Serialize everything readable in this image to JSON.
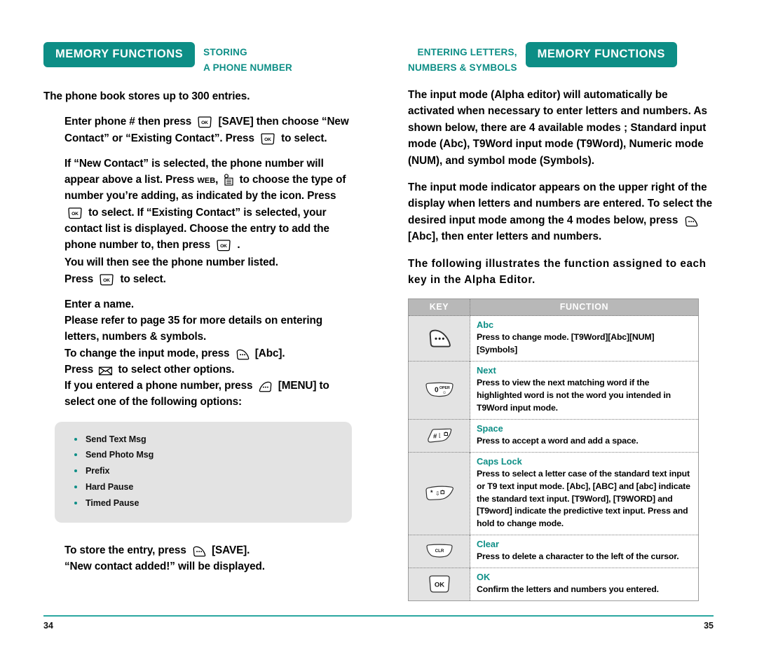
{
  "left_page": {
    "badge": "MEMORY FUNCTIONS",
    "section_title_line1": "STORING",
    "section_title_line2": "A PHONE NUMBER",
    "intro": "The phone book stores up to 300 entries.",
    "p1_a": "Enter phone # then press",
    "p1_b": "[SAVE] then choose “New Contact” or “Existing Contact”. Press",
    "p1_c": "to select.",
    "p2_a": "If “New Contact” is selected, the phone number will appear above a list. Press",
    "p2_web": "WEB",
    "p2_b": "to choose the type of number you’re adding, as indicated by the icon. Press",
    "p2_c": "to select. If “Existing Contact” is selected, your contact list is displayed. Choose the entry to add the phone number to, then press",
    "p2_d": ".",
    "p3_a": "You will then see the phone number listed.",
    "p3_b": "Press",
    "p3_c": "to select.",
    "p4_a": "Enter a name.",
    "p4_b": "Please refer to page 35 for more details on entering letters, numbers & symbols.",
    "p4_c": "To change the input mode, press",
    "p4_d": "[Abc].",
    "p4_e": "Press",
    "p4_f": "to select other options.",
    "p4_g": "If you entered a phone number, press",
    "p4_h": "[MENU] to select one of the following options:",
    "options": [
      "Send Text Msg",
      "Send Photo Msg",
      "Prefix",
      "Hard Pause",
      "Timed Pause"
    ],
    "p5_a": "To store the entry, press",
    "p5_b": "[SAVE].",
    "p5_c": "“New contact added!” will be displayed.",
    "page_number": "34"
  },
  "right_page": {
    "badge": "MEMORY FUNCTIONS",
    "section_title_line1": "ENTERING LETTERS,",
    "section_title_line2": "NUMBERS & SYMBOLS",
    "p1": "The input mode (Alpha editor) will automatically be activated when necessary to enter letters and numbers. As shown below, there are 4 available modes ; Standard input mode (Abc), T9Word input mode (T9Word), Numeric mode (NUM), and symbol mode (Symbols).",
    "p2_a": "The input mode indicator appears on the upper right of the display when letters and numbers are entered. To select the desired input mode among the 4 modes below, press",
    "p2_b": "[Abc], then enter letters and numbers.",
    "p3": "The following illustrates the function assigned to each key in the Alpha Editor.",
    "table": {
      "header_key": "KEY",
      "header_function": "FUNCTION",
      "rows": [
        {
          "key_icon": "softkey-right-icon",
          "key_label": "",
          "title": "Abc",
          "desc": "Press to change mode. [T9Word][Abc][NUM][Symbols]"
        },
        {
          "key_icon": "zero-oper-key-icon",
          "key_label": "0",
          "key_sub": "OPER",
          "title": "Next",
          "desc": "Press to view the next matching word if the highlighted word is not the word you intended in T9Word input mode."
        },
        {
          "key_icon": "pound-space-key-icon",
          "key_label": "#",
          "title": "Space",
          "desc": "Press to accept a word and add a space."
        },
        {
          "key_icon": "star-shift-key-icon",
          "key_label": "*",
          "title": "Caps Lock",
          "desc": "Press to select a letter case of the standard text input or T9 text input mode. [Abc], [ABC] and [abc] indicate the standard text input. [T9Word], [T9WORD] and [T9word] indicate the predictive text input. Press and hold to change mode."
        },
        {
          "key_icon": "clr-key-icon",
          "key_label": "CLR",
          "title": "Clear",
          "desc": "Press to delete a character to the left of the cursor."
        },
        {
          "key_icon": "ok-key-icon",
          "key_label": "OK",
          "title": "OK",
          "desc": "Confirm the letters and numbers you entered."
        }
      ]
    },
    "page_number": "35"
  },
  "colors": {
    "accent_teal": "#0d8e86",
    "rule_teal": "#2aa7a0",
    "panel_grey": "#e3e3e3",
    "table_header_grey": "#b8b8b8"
  }
}
